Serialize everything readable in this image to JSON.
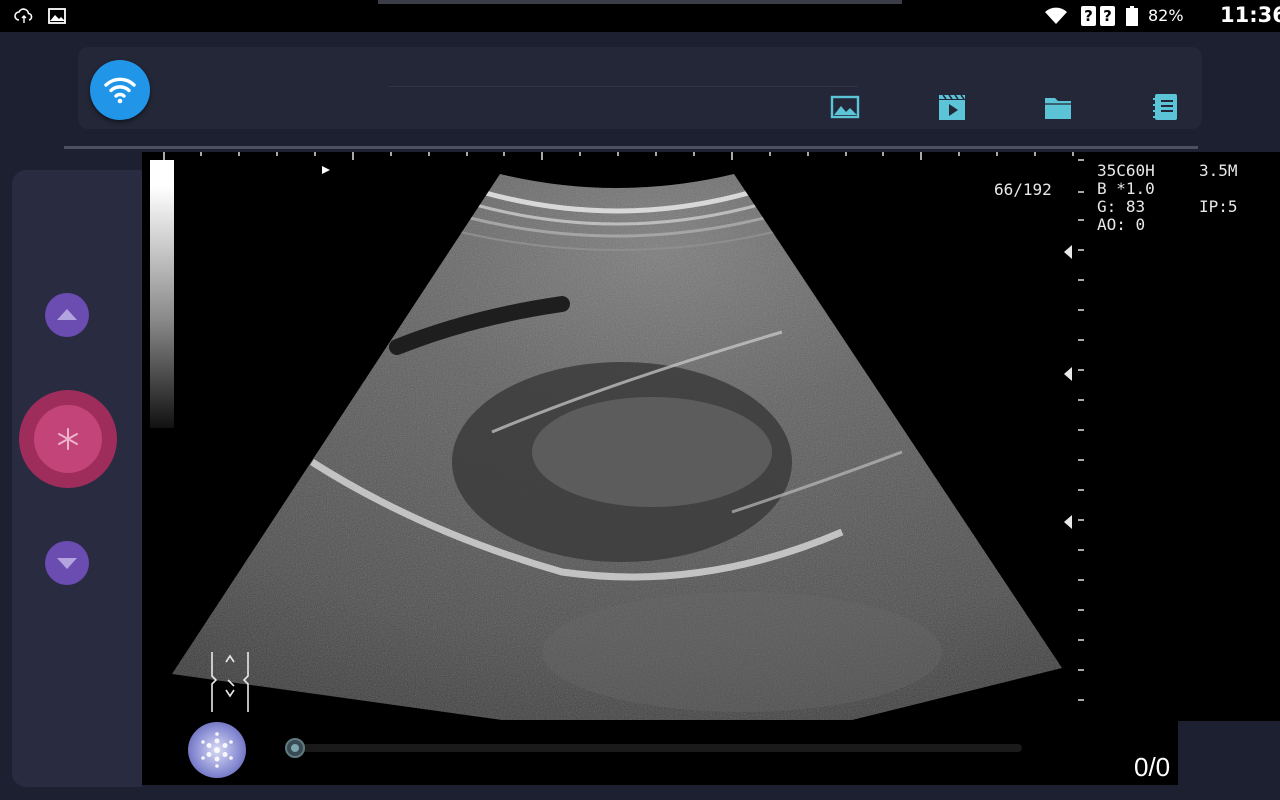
{
  "status_bar": {
    "battery": "82%",
    "time": "11:36",
    "unknown_sim_1": "?",
    "unknown_sim_2": "?"
  },
  "toolbar": {
    "icons": [
      "wifi-icon",
      "image-icon",
      "video-icon",
      "folder-icon",
      "report-icon"
    ]
  },
  "display": {
    "frame_counter": "66/192",
    "probe": "35C60H",
    "frequency": "3.5M",
    "mode_line": "B *1.0",
    "gain": "G: 83",
    "ip": "IP:5",
    "ao": "AO: 0",
    "cine_count": "0/0"
  },
  "colors": {
    "accent_blue": "#2196e8",
    "button_purple": "#6b4cb0",
    "freeze_red": "#c24478",
    "toolbar_icon": "#5bc4d6"
  }
}
